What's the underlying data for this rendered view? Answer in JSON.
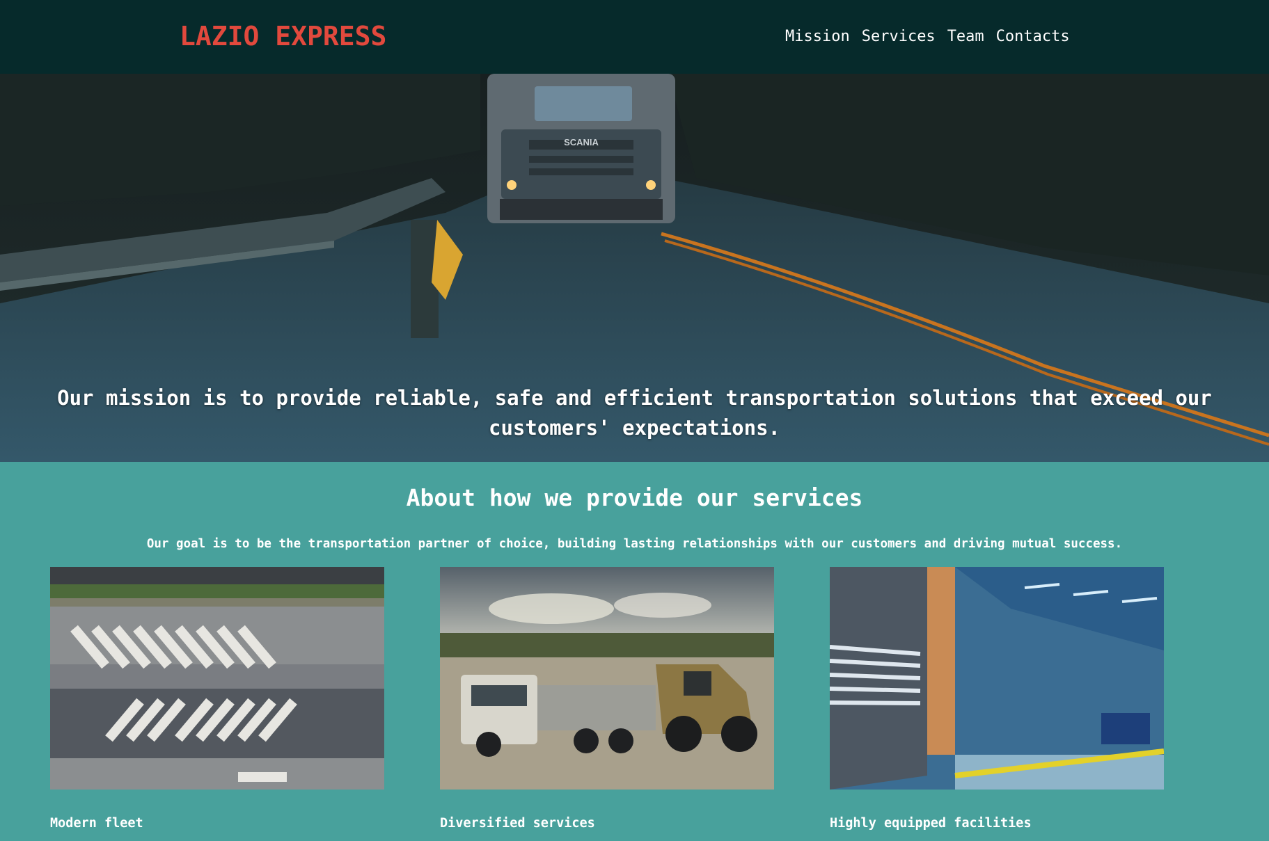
{
  "header": {
    "logo": "LAZIO EXPRESS",
    "nav": [
      "Mission",
      "Services",
      "Team",
      "Contacts"
    ]
  },
  "hero": {
    "mission_text": "Our mission is to provide reliable, safe and efficient transportation solutions that exceed our customers' expectations.",
    "truck_brand": "SCANIA"
  },
  "about": {
    "title": "About how we provide our services",
    "subtitle": "Our goal is to be the transportation partner of choice, building lasting relationships with our customers and driving mutual success.",
    "cards": [
      {
        "caption": "Modern fleet",
        "image": "aerial-truck-parking-image"
      },
      {
        "caption": "Diversified services",
        "image": "quarry-truck-loader-image"
      },
      {
        "caption": "Highly equipped facilities",
        "image": "warehouse-loading-dock-image"
      }
    ]
  }
}
